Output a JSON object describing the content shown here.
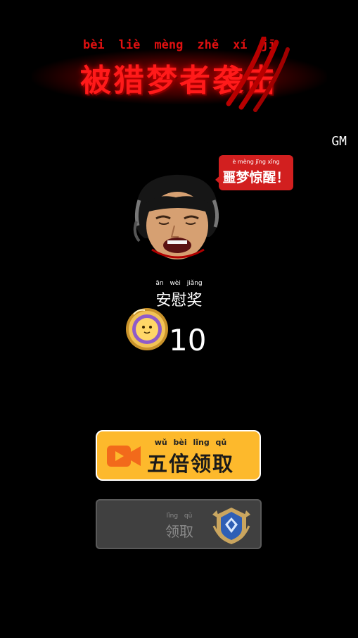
{
  "title": {
    "pinyin": [
      "bèi",
      "liè",
      "mèng",
      "zhě",
      "xí",
      "jī"
    ],
    "text": "被猎梦者袭击"
  },
  "gm_label": "GM",
  "speech_bubble": {
    "pinyin": "è mèng jīng xǐng",
    "text": "噩梦惊醒！"
  },
  "reward": {
    "pinyin": "ān wèi jiǎng",
    "text": "安慰奖",
    "amount": "10"
  },
  "buttons": {
    "five_times": {
      "pinyin": "wǔ bèi lǐng qǔ",
      "label": "五倍领取"
    },
    "claim": {
      "pinyin": "lǐng qǔ",
      "label": "领取"
    }
  },
  "colors": {
    "title_red": "#ff1a1a",
    "bubble_red": "#d21f1f",
    "five_button_yellow": "#fdb92c",
    "video_icon_orange": "#f26a1b",
    "claim_button_gray": "#404040"
  },
  "icons": {
    "claw": "claw-scratch-icon",
    "avatar": "crying-face-avatar",
    "coin": "coin-icon",
    "video": "video-camera-icon",
    "rank": "rank-emblem-icon"
  }
}
